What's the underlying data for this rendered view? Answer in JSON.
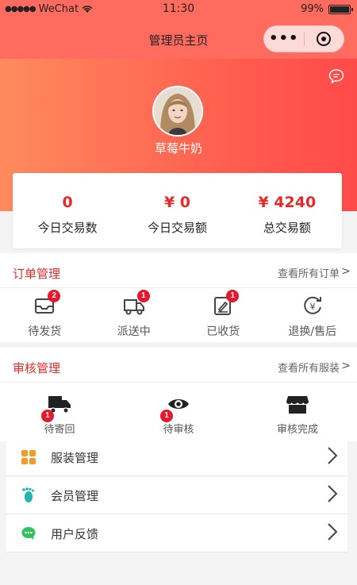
{
  "status_bar": {
    "carrier": "WeChat",
    "time": "11:30",
    "battery": "99%",
    "battery_level": 0.99
  },
  "nav": {
    "title": "管理员主页",
    "more_label": "•••"
  },
  "profile": {
    "username": "草莓牛奶"
  },
  "stats": [
    {
      "value": "0",
      "label": "今日交易数"
    },
    {
      "value": "¥ 0",
      "label": "今日交易额"
    },
    {
      "value": "¥ 4240",
      "label": "总交易额"
    }
  ],
  "orders": {
    "title": "订单管理",
    "link": "查看所有订单",
    "items": [
      {
        "label": "待发货",
        "badge": "2",
        "icon": "inbox-icon"
      },
      {
        "label": "派送中",
        "badge": "1",
        "icon": "delivery-truck-icon"
      },
      {
        "label": "已收货",
        "badge": "1",
        "icon": "signed-receipt-icon"
      },
      {
        "label": "退换/售后",
        "badge": "",
        "icon": "refund-icon"
      }
    ]
  },
  "review": {
    "title": "审核管理",
    "link": "查看所有服装",
    "items": [
      {
        "label": "待寄回",
        "badge": "1",
        "icon": "truck-icon"
      },
      {
        "label": "待审核",
        "badge": "1",
        "icon": "eye-icon"
      },
      {
        "label": "审核完成",
        "badge": "",
        "icon": "shop-icon"
      }
    ]
  },
  "menu": [
    {
      "label": "服装管理",
      "icon": "grid-icon",
      "color": "#f59a23"
    },
    {
      "label": "会员管理",
      "icon": "footprint-icon",
      "color": "#1fb8b0"
    },
    {
      "label": "用户反馈",
      "icon": "chat-bubble-icon",
      "color": "#2fc25b"
    }
  ],
  "colors": {
    "accent": "#e62a2a",
    "header": "#ff6b5e",
    "badge": "#e8172e"
  }
}
